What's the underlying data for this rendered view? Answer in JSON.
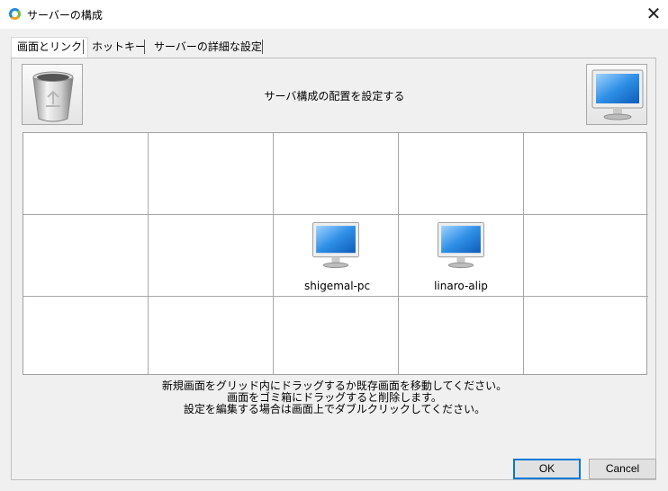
{
  "window": {
    "title": "サーバーの構成",
    "close_glyph": "✕"
  },
  "tabs": [
    {
      "label": "画面とリンク",
      "active": true
    },
    {
      "label": "ホットキー",
      "active": false
    },
    {
      "label": "サーバーの詳細な設定",
      "active": false
    }
  ],
  "panel": {
    "header_text": "サーバ構成の配置を設定する",
    "bin_icon": "recycle-bin-icon",
    "new_screen_icon": "monitor-icon"
  },
  "grid": {
    "columns": 5,
    "rows": 3,
    "screens": [
      {
        "name": "shigemal-pc",
        "row": 1,
        "col": 2
      },
      {
        "name": "linaro-alip",
        "row": 1,
        "col": 3
      }
    ]
  },
  "instructions": [
    "新規画面をグリッド内にドラッグするか既存画面を移動してください。",
    "画面をゴミ箱にドラッグすると削除します。",
    "設定を編集する場合は画面上でダブルクリックしてください。"
  ],
  "buttons": {
    "ok": "OK",
    "cancel": "Cancel"
  },
  "colors": {
    "accent": "#0078d7",
    "screen_blue": "#2f8fe6"
  }
}
